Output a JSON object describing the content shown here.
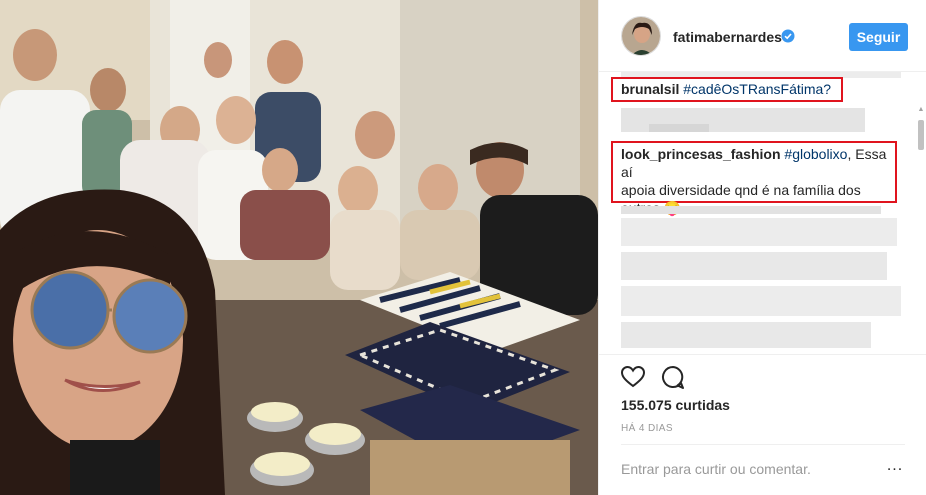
{
  "post": {
    "username": "fatimabernardes",
    "follow_label": "Seguir",
    "likes": "155.075 curtidas",
    "timestamp": "HÁ 4 DIAS"
  },
  "comments": [
    {
      "user": "brunalsil",
      "text": "#cadêOsTRansFátima?"
    },
    {
      "user": "look_princesas_fashion",
      "tag": "#globolixo",
      "text_line1": ", Essa aí",
      "text_line2": "apoia diversidade qnd é na família dos",
      "text_line3": "outros 😝"
    }
  ],
  "composer": {
    "placeholder": "Entrar para curtir ou comentar.",
    "more_label": "..."
  },
  "icons": [
    "verified-badge-icon",
    "heart-icon",
    "comment-bubble-icon",
    "more-options-icon"
  ],
  "colors": {
    "follow_button": "#3897f0",
    "highlight_box": "#e0141e",
    "verified": "#3897f0"
  }
}
